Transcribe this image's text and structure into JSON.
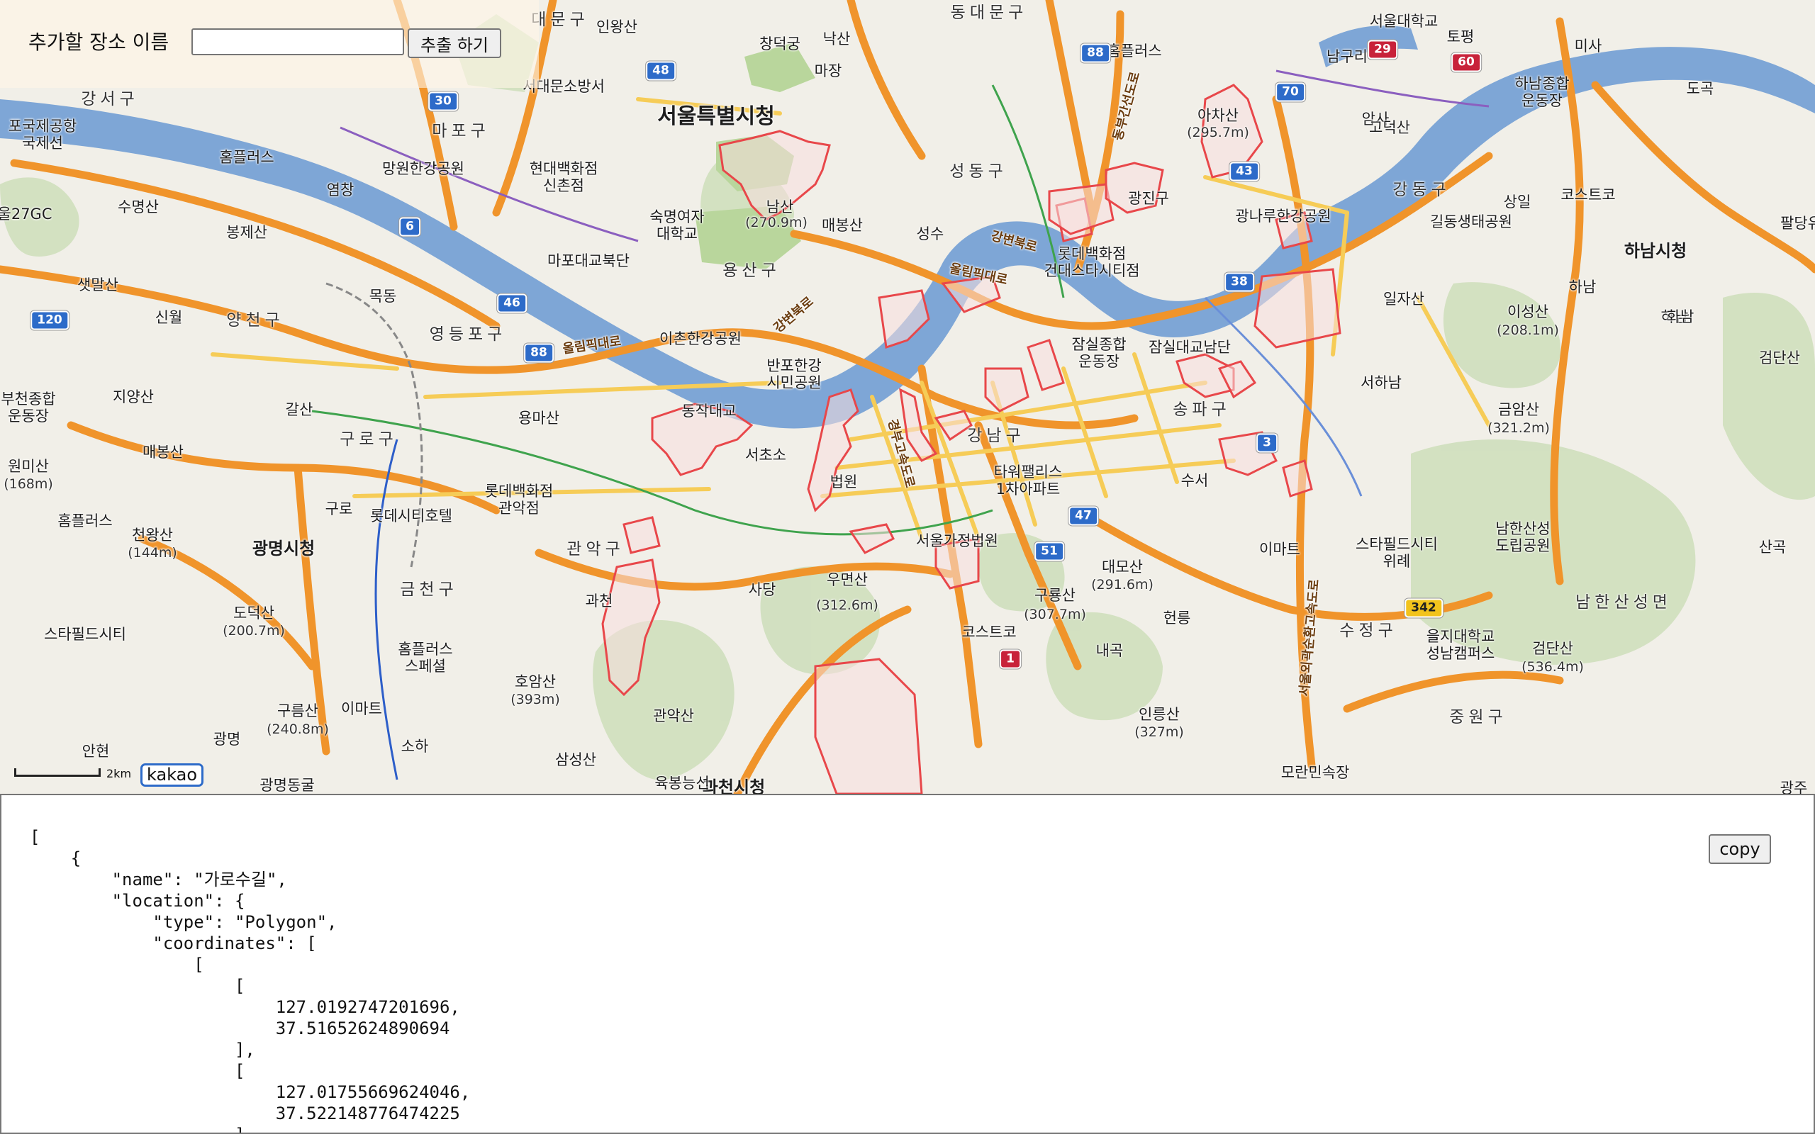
{
  "search": {
    "label": "추가할 장소 이름",
    "input_value": "",
    "button_label": "추출 하기"
  },
  "map": {
    "scale_label": "2km",
    "logo_text": "kakao",
    "labels": {
      "seoul_city_hall": "서울특별시청",
      "hanam_city_hall": "하남시청",
      "gwangmyeong_city_hall": "광명시청",
      "gwacheon_city_hall": "과천시청",
      "dongdaemun_gu": "동대문구",
      "daemun_gu": "대문구",
      "yongsan_gu": "용산구",
      "seongdong_gu": "성동구",
      "gangnam_gu": "강남구",
      "songpa_gu": "송파구",
      "gangdong_gu": "강동구",
      "yangcheon_gu": "양천구",
      "yeongdeungpo_gu": "영등포구",
      "guro_gu": "구로구",
      "geumcheon_gu": "금천구",
      "gwanak_gu": "관악구",
      "mapo_gu": "마포구",
      "gangseo_gu": "강서구",
      "sujeong_gu": "수정구",
      "jungwon_gu": "중원구",
      "namhansanseong_myeon": "남한산성면",
      "namguri": "남구리",
      "inwangsan": "인왕산",
      "changdeokgung": "창덕궁",
      "naksan": "낙산",
      "seodaemun_station": "서대문소방서",
      "hyundai_sinchon": "현대백화점\n신촌점",
      "sookmyung": "숙명여자\n대학교",
      "namsan": "남산",
      "namsan_height": "(270.9m)",
      "maebongsan": "매봉산",
      "mapo_bridge": "마포대교북단",
      "mangwon_park": "망원한강공원",
      "ichon_park": "이촌한강공원",
      "banpo_park": "반포한강\n시민공원",
      "dongjak_bridge": "동작대교",
      "seocho": "서초소",
      "court": "법원",
      "lotte_gwanak": "롯데백화점\n관악점",
      "lotte_city_hotel": "롯데시티호텔",
      "tower_palace": "타워팰리스\n1차아파트",
      "seoul_family_court": "서울가정법원",
      "costco_yangjae": "코스트코",
      "umyeonsan": "우면산",
      "umyeonsan_height": "(312.6m)",
      "gwanaksan": "관악산",
      "homansan": "호암산",
      "homansan_height": "(393m)",
      "samseongsan": "삼성산",
      "yukbongneungseon": "육봉능선",
      "guryongsan": "구룡산",
      "guryongsan_height": "(307.7m)",
      "daemosan": "대모산",
      "daemosan_height": "(291.6m)",
      "inneungsan": "인릉산",
      "inneungsan_height": "(327m)",
      "jamsil_bridge": "잠실대교남단",
      "jamsil_sports": "잠실종합\n운동장",
      "lotte_konkuk": "롯데백화점\n건대스타시티점",
      "achasan": "아차산",
      "achasan_height": "(295.7m)",
      "gwangjin": "광진구",
      "gangdong_park": "광나루한강공원",
      "gildong": "길동생태공원",
      "costco_sangil": "코스트코",
      "hanam_sports": "하남종합\n운동장",
      "ilnasan": "일자산",
      "iseongsan": "이성산",
      "iseongsan_height": "(208.1m)",
      "geumamsan": "금암산",
      "geumamsan_height": "(321.2m)",
      "namhansanseong": "남한산성\n도립공원",
      "starfield_wirye": "스타필드시티\n위례",
      "emart_wirye": "이마트",
      "eulji_univ": "을지대학교\n성남캠퍼스",
      "geomdansan": "검단산",
      "geomdansan_height": "(536.4m)",
      "seoul_univ_seoul": "서울대학교",
      "homeplus_dongdaemun": "홈플러스",
      "homeplus_hapjeong": "홈플러스",
      "homeplus_guro": "홈플러스",
      "homeplus_siheung": "홈플러스\n스페셜",
      "starfield_city": "스타필드시티",
      "emart_geumcheon": "이마트",
      "sumyeongsan": "수명산",
      "bonjesan": "봉제산",
      "saetmal": "샛말산",
      "sinwol": "신월",
      "jiyangsan": "지양산",
      "maebongsan_w": "매봉산",
      "wonmisan": "원미산",
      "wonmisan_height": "(168m)",
      "cheonwangsan": "천왕산",
      "cheonwangsan_height": "(144m)",
      "dodeoksan": "도덕산",
      "dodeoksan_height": "(200.7m)",
      "gureumsan": "구름산",
      "gureumsan_height": "(240.8m)",
      "mokdong": "목동",
      "galsan": "갈산",
      "yongmasan": "용마산",
      "guro": "구로",
      "gwangmyeong": "광명",
      "anhyeon": "안현",
      "soha": "소하",
      "gwangmyeong_dong": "광명동굴",
      "bucheon_sports": "부천종합\n운동장",
      "gimpo_airport": "포국제공항\n국제선",
      "yeomchang": "염창",
      "gangseo_gc": "울27GC",
      "seongsu": "성수",
      "sangil": "상일",
      "hanam": "하남",
      "hanam2": "하남",
      "misa": "미사",
      "topyeong": "토평",
      "doksan": "도곡",
      "amsa": "암사",
      "godeoksan": "고덕산",
      "sanggok": "산곡",
      "paldang": "팔당유",
      "seohanam": "서하남",
      "geomdansan_e": "검단산",
      "hwanamsan": "화남",
      "suseo": "수서",
      "hyeonreung": "헌릉",
      "naegok": "내곡",
      "sadang": "사당",
      "gwacheon_lbl": "과천",
      "morak": "모란민속장",
      "gwangju": "광주",
      "majang": "마장"
    },
    "road_labels": {
      "olympic_1": "올림픽대로",
      "olympic_2": "올림픽대로",
      "gangbyeon_1": "강변북로",
      "gangbyeon_2": "강변북로",
      "gyeongbu": "경부고속도로",
      "seoul_ring": "서울외곽순환고속도로",
      "dongbu": "동부간선도로"
    },
    "shields": [
      "30",
      "6",
      "46",
      "88",
      "88",
      "48",
      "70",
      "29",
      "60",
      "43",
      "38",
      "3",
      "47",
      "51",
      "1",
      "120",
      "342"
    ]
  },
  "json_output": {
    "text": "[\n    {\n        \"name\": \"가로수길\",\n        \"location\": {\n            \"type\": \"Polygon\",\n            \"coordinates\": [\n                [\n                    [\n                        127.0192747201696,\n                        37.51652624890694\n                    ],\n                    [\n                        127.01755669624046,\n                        37.522148776474225\n                    ],",
    "copy_label": "copy"
  },
  "colors": {
    "land": "#f1efe8",
    "river": "#7ea6d6",
    "highway": "#f0942b",
    "park": "#c9ddb4",
    "polygon_stroke": "#e8474a",
    "polygon_fill": "#f7dede"
  }
}
